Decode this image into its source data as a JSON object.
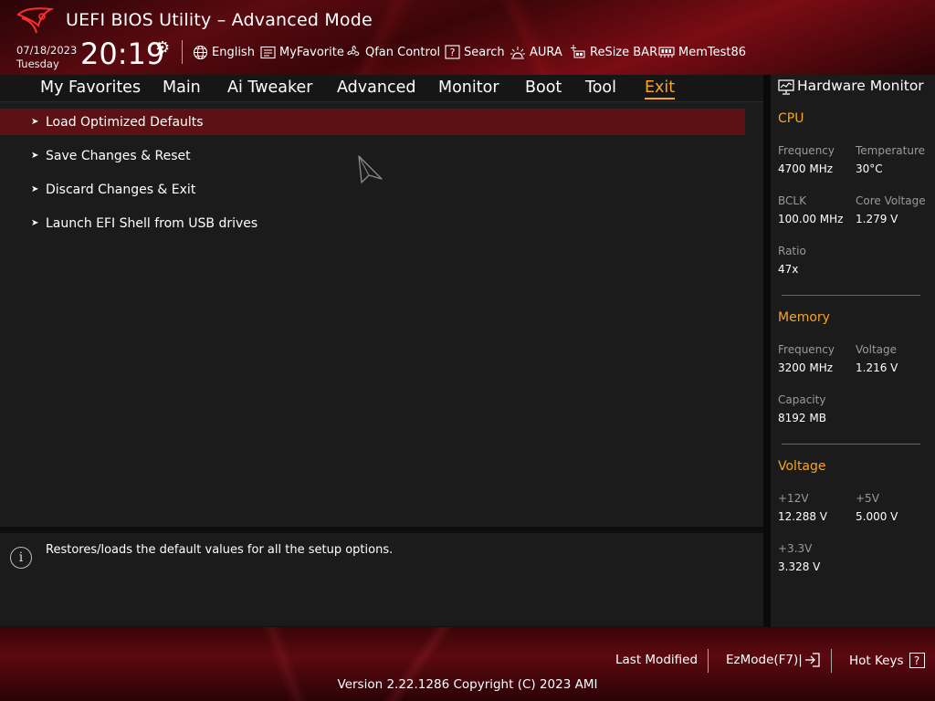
{
  "header": {
    "title": "UEFI BIOS Utility – Advanced Mode",
    "date": "07/18/2023",
    "day": "Tuesday",
    "time": "20:19",
    "tools": [
      {
        "label": "English",
        "icon": "globe-icon"
      },
      {
        "label": "MyFavorite",
        "icon": "favorite-list-icon"
      },
      {
        "label": "Qfan Control",
        "icon": "fan-icon"
      },
      {
        "label": "Search",
        "icon": "question-box-icon"
      },
      {
        "label": "AURA",
        "icon": "aura-light-icon"
      },
      {
        "label": "ReSize BAR",
        "icon": "resize-bar-icon"
      },
      {
        "label": "MemTest86",
        "icon": "memory-icon"
      }
    ]
  },
  "nav": {
    "tabs": [
      "My Favorites",
      "Main",
      "Ai Tweaker",
      "Advanced",
      "Monitor",
      "Boot",
      "Tool",
      "Exit"
    ],
    "active": "Exit"
  },
  "menu": {
    "items": [
      "Load Optimized Defaults",
      "Save Changes & Reset",
      "Discard Changes & Exit",
      "Launch EFI Shell from USB drives"
    ],
    "selected_index": 0
  },
  "help": {
    "text": "Restores/loads the default values for all the setup options."
  },
  "hardware_monitor": {
    "title": "Hardware Monitor",
    "cpu": {
      "title": "CPU",
      "frequency_label": "Frequency",
      "frequency": "4700 MHz",
      "temperature_label": "Temperature",
      "temperature": "30°C",
      "bclk_label": "BCLK",
      "bclk": "100.00 MHz",
      "core_voltage_label": "Core Voltage",
      "core_voltage": "1.279 V",
      "ratio_label": "Ratio",
      "ratio": "47x"
    },
    "memory": {
      "title": "Memory",
      "frequency_label": "Frequency",
      "frequency": "3200 MHz",
      "voltage_label": "Voltage",
      "voltage": "1.216 V",
      "capacity_label": "Capacity",
      "capacity": "8192 MB"
    },
    "voltage": {
      "title": "Voltage",
      "v12_label": "+12V",
      "v12": "12.288 V",
      "v5_label": "+5V",
      "v5": "5.000 V",
      "v33_label": "+3.3V",
      "v33": "3.328 V"
    }
  },
  "footer": {
    "last_modified": "Last Modified",
    "ezmode": "EzMode(F7)|",
    "hotkeys": "Hot Keys",
    "hotkeys_key": "?",
    "version": "Version 2.22.1286 Copyright (C) 2023 AMI"
  },
  "colors": {
    "accent": "#f5a623",
    "selected_row": "#5c1214",
    "panel": "#1b1b1b"
  }
}
